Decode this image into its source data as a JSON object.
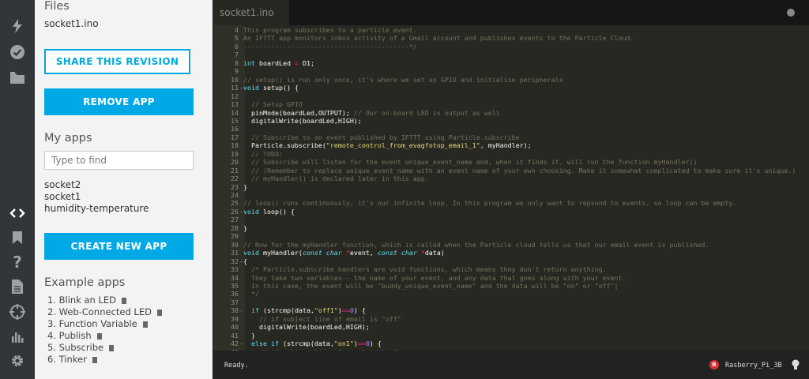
{
  "rail": {
    "icons": [
      "flash-icon",
      "verify-icon",
      "folder-icon",
      "code-icon",
      "bookmark-icon",
      "help-icon",
      "document-icon",
      "target-icon",
      "console-icon",
      "settings-icon"
    ]
  },
  "panel": {
    "files_heading": "Files",
    "current_file": "socket1.ino",
    "share_label": "SHARE THIS REVISION",
    "remove_label": "REMOVE APP",
    "my_apps_heading": "My apps",
    "search_placeholder": "Type to find",
    "apps": [
      "socket2",
      "socket1",
      "humidity-temperature"
    ],
    "create_label": "CREATE NEW APP",
    "examples_heading": "Example apps",
    "examples": [
      "1. Blink an LED",
      "2. Web-Connected LED",
      "3. Function Variable",
      "4. Publish",
      "5. Subscribe",
      "6. Tinker"
    ]
  },
  "editor": {
    "tab_name": "socket1.ino",
    "status": "Ready.",
    "device_initial": "R",
    "device_name": "Rasberry_Pi_3B",
    "lines": [
      {
        "n": "4",
        "f": "",
        "p": [
          [
            "c-com",
            "This program subscribes to a particle event."
          ]
        ]
      },
      {
        "n": "5",
        "f": "",
        "p": [
          [
            "c-com",
            "An IFTTT app monitors inbox activity of a Gmail account and publishes events to the Particle Cloud."
          ]
        ]
      },
      {
        "n": "6",
        "f": "",
        "p": [
          [
            "c-com",
            "------------------------------------------*/"
          ]
        ]
      },
      {
        "n": "7",
        "f": "",
        "p": []
      },
      {
        "n": "8",
        "f": "",
        "p": [
          [
            "c-kw",
            "int"
          ],
          [
            "",
            " boardLed "
          ],
          [
            "c-op",
            "="
          ],
          [
            "",
            " D1;"
          ]
        ]
      },
      {
        "n": "9",
        "f": "",
        "p": []
      },
      {
        "n": "10",
        "f": "",
        "p": [
          [
            "c-com",
            "// setup() is run only once, it's where we set up GPIO and initialise peripherals"
          ]
        ]
      },
      {
        "n": "11",
        "f": "-",
        "p": [
          [
            "c-kw",
            "void"
          ],
          [
            "",
            " setup() {"
          ]
        ]
      },
      {
        "n": "12",
        "f": "",
        "p": []
      },
      {
        "n": "13",
        "f": "",
        "p": [
          [
            "c-com",
            "  // Setup GPIO"
          ]
        ]
      },
      {
        "n": "14",
        "f": "",
        "p": [
          [
            "",
            "  pinMode(boardLed,OUTPUT); "
          ],
          [
            "c-com",
            "// Our on-board LED is output as well"
          ]
        ]
      },
      {
        "n": "15",
        "f": "",
        "p": [
          [
            "",
            "  digitalWrite(boardLed,HIGH);"
          ]
        ]
      },
      {
        "n": "16",
        "f": "",
        "p": []
      },
      {
        "n": "17",
        "f": "",
        "p": [
          [
            "c-com",
            "  // Subscribe to an event published by IFTTT using Particle.subscribe"
          ]
        ]
      },
      {
        "n": "18",
        "f": "",
        "p": [
          [
            "",
            "  Particle.subscribe("
          ],
          [
            "c-str",
            "\"remote_control_from_evagfotop_email_1\""
          ],
          [
            "",
            ", myHandler);"
          ]
        ]
      },
      {
        "n": "19",
        "f": "",
        "p": [
          [
            "c-com",
            "  // TODO:"
          ]
        ]
      },
      {
        "n": "20",
        "f": "",
        "p": [
          [
            "c-com",
            "  // Subscribe will listen for the event unique_event_name and, when it finds it, will run the function myHandler()"
          ]
        ]
      },
      {
        "n": "21",
        "f": "",
        "p": [
          [
            "c-com",
            "  // (Remember to replace unique_event_name with an event name of your own choosing. Make it somewhat complicated to make sure it's unique.)"
          ]
        ]
      },
      {
        "n": "22",
        "f": "",
        "p": [
          [
            "c-com",
            "  // myHandler() is declared later in this app."
          ]
        ]
      },
      {
        "n": "23",
        "f": "",
        "p": [
          [
            "",
            "}"
          ]
        ]
      },
      {
        "n": "24",
        "f": "",
        "p": []
      },
      {
        "n": "25",
        "f": "",
        "p": [
          [
            "c-com",
            "// loop() runs continuously, it's our infinite loop. In this program we only want to repsond to events, so loop can be empty."
          ]
        ]
      },
      {
        "n": "26",
        "f": "-",
        "p": [
          [
            "c-kw",
            "void"
          ],
          [
            "",
            " loop() {"
          ]
        ]
      },
      {
        "n": "27",
        "f": "",
        "p": []
      },
      {
        "n": "28",
        "f": "",
        "p": [
          [
            "",
            "}"
          ]
        ]
      },
      {
        "n": "29",
        "f": "",
        "p": []
      },
      {
        "n": "30",
        "f": "",
        "p": [
          [
            "c-com",
            "// Now for the myHandler function, which is called when the Particle cloud tells us that our email event is published."
          ]
        ]
      },
      {
        "n": "31",
        "f": "",
        "p": [
          [
            "c-kw",
            "void"
          ],
          [
            "",
            " myHandler("
          ],
          [
            "c-it",
            "const char"
          ],
          [
            "",
            " "
          ],
          [
            "c-op",
            "*"
          ],
          [
            "",
            "event, "
          ],
          [
            "c-it",
            "const char"
          ],
          [
            "",
            " "
          ],
          [
            "c-op",
            "*"
          ],
          [
            "",
            "data)"
          ]
        ]
      },
      {
        "n": "32",
        "f": "-",
        "p": [
          [
            "",
            "{"
          ]
        ]
      },
      {
        "n": "33",
        "f": "",
        "p": [
          [
            "c-com",
            "  /* Particle.subscribe handlers are void functions, which means they don't return anything."
          ]
        ]
      },
      {
        "n": "34",
        "f": "",
        "p": [
          [
            "c-com",
            "  They take two variables-- the name of your event, and any data that goes along with your event."
          ]
        ]
      },
      {
        "n": "35",
        "f": "",
        "p": [
          [
            "c-com",
            "  In this case, the event will be \"buddy_unique_event_name\" and the data will be \"on\" or \"off\"|"
          ]
        ]
      },
      {
        "n": "36",
        "f": "",
        "p": [
          [
            "c-com",
            "  */"
          ]
        ]
      },
      {
        "n": "37",
        "f": "",
        "p": []
      },
      {
        "n": "38",
        "f": "-",
        "p": [
          [
            "",
            "  "
          ],
          [
            "c-kw",
            "if"
          ],
          [
            "",
            " (strcmp(data,"
          ],
          [
            "c-str",
            "\"off1\""
          ],
          [
            "",
            ")"
          ],
          [
            "c-op",
            "=="
          ],
          [
            "c-num",
            "0"
          ],
          [
            "",
            ") {"
          ]
        ]
      },
      {
        "n": "39",
        "f": "",
        "p": [
          [
            "c-com",
            "    // if subject line of email is \"off\""
          ]
        ]
      },
      {
        "n": "40",
        "f": "",
        "p": [
          [
            "",
            "    digitalWrite(boardLed,HIGH);"
          ]
        ]
      },
      {
        "n": "41",
        "f": "",
        "p": [
          [
            "",
            "  }"
          ]
        ]
      },
      {
        "n": "42",
        "f": "-",
        "p": [
          [
            "",
            "  "
          ],
          [
            "c-kw",
            "else if"
          ],
          [
            "",
            " (strcmp(data,"
          ],
          [
            "c-str",
            "\"on1\""
          ],
          [
            "",
            ")"
          ],
          [
            "c-op",
            "=="
          ],
          [
            "c-num",
            "0"
          ],
          [
            "",
            ") {"
          ]
        ]
      },
      {
        "n": "43",
        "f": "",
        "p": [
          [
            "c-com",
            "    // if subject line of email is \"on\""
          ]
        ]
      }
    ]
  }
}
